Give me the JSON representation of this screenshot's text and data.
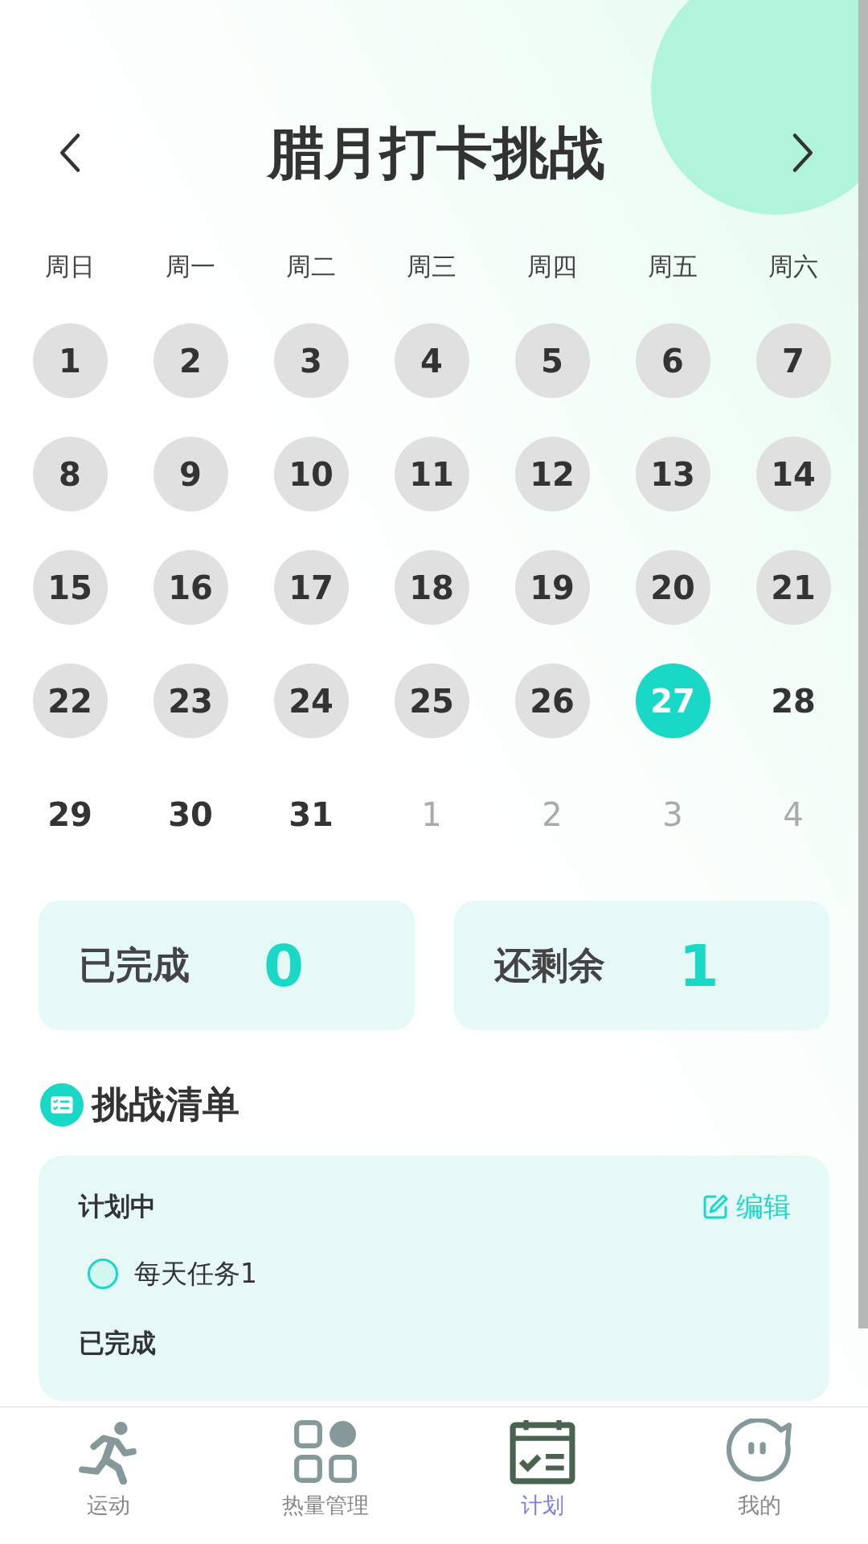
{
  "header": {
    "title": "腊月打卡挑战"
  },
  "weekdays": [
    "周日",
    "周一",
    "周二",
    "周三",
    "周四",
    "周五",
    "周六"
  ],
  "days": [
    {
      "label": "1",
      "kind": "past"
    },
    {
      "label": "2",
      "kind": "past"
    },
    {
      "label": "3",
      "kind": "past"
    },
    {
      "label": "4",
      "kind": "past"
    },
    {
      "label": "5",
      "kind": "past"
    },
    {
      "label": "6",
      "kind": "past"
    },
    {
      "label": "7",
      "kind": "past"
    },
    {
      "label": "8",
      "kind": "past"
    },
    {
      "label": "9",
      "kind": "past"
    },
    {
      "label": "10",
      "kind": "past"
    },
    {
      "label": "11",
      "kind": "past"
    },
    {
      "label": "12",
      "kind": "past"
    },
    {
      "label": "13",
      "kind": "past"
    },
    {
      "label": "14",
      "kind": "past"
    },
    {
      "label": "15",
      "kind": "past"
    },
    {
      "label": "16",
      "kind": "past"
    },
    {
      "label": "17",
      "kind": "past"
    },
    {
      "label": "18",
      "kind": "past"
    },
    {
      "label": "19",
      "kind": "past"
    },
    {
      "label": "20",
      "kind": "past"
    },
    {
      "label": "21",
      "kind": "past"
    },
    {
      "label": "22",
      "kind": "past"
    },
    {
      "label": "23",
      "kind": "past"
    },
    {
      "label": "24",
      "kind": "past"
    },
    {
      "label": "25",
      "kind": "past"
    },
    {
      "label": "26",
      "kind": "past"
    },
    {
      "label": "27",
      "kind": "today"
    },
    {
      "label": "28",
      "kind": "future"
    },
    {
      "label": "29",
      "kind": "future"
    },
    {
      "label": "30",
      "kind": "future"
    },
    {
      "label": "31",
      "kind": "future"
    },
    {
      "label": "1",
      "kind": "other"
    },
    {
      "label": "2",
      "kind": "other"
    },
    {
      "label": "3",
      "kind": "other"
    },
    {
      "label": "4",
      "kind": "other"
    }
  ],
  "stats": [
    {
      "label": "已完成",
      "value": "0"
    },
    {
      "label": "还剩余",
      "value": "1"
    }
  ],
  "section": {
    "title": "挑战清单"
  },
  "list": {
    "planned_title": "计划中",
    "edit_label": "编辑",
    "tasks": [
      {
        "label": "每天任务1",
        "checked": false
      }
    ],
    "done_title": "已完成"
  },
  "nav": [
    {
      "label": "运动",
      "selected": false
    },
    {
      "label": "热量管理",
      "selected": false
    },
    {
      "label": "计划",
      "selected": true
    },
    {
      "label": "我的",
      "selected": false
    }
  ]
}
